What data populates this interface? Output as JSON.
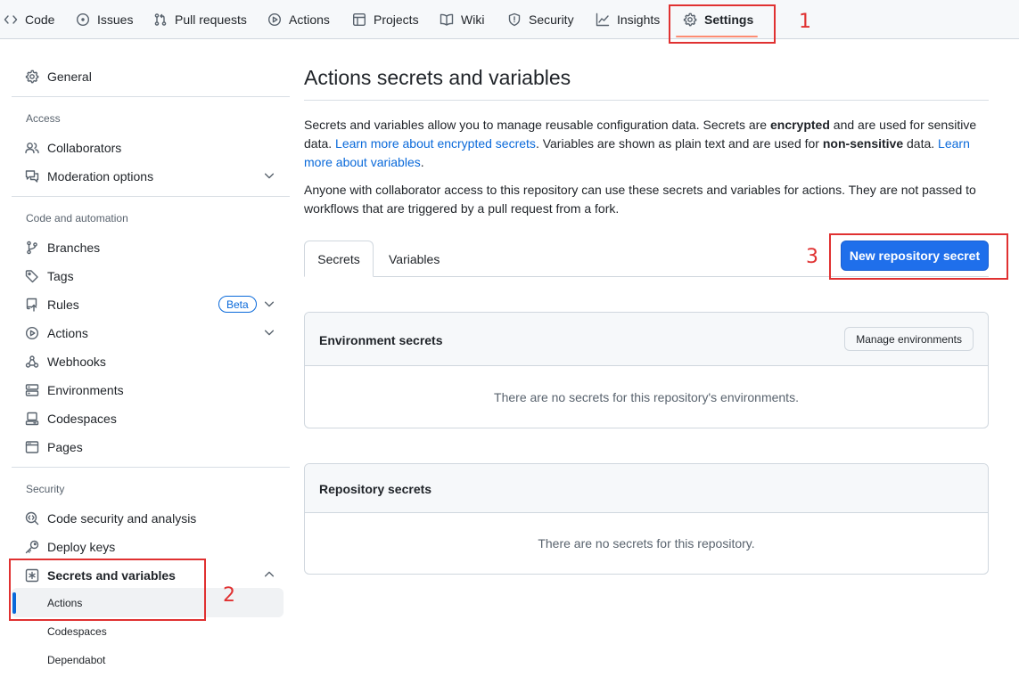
{
  "topnav": {
    "tabs": [
      {
        "label": "Code",
        "icon": "code-icon"
      },
      {
        "label": "Issues",
        "icon": "issue-icon"
      },
      {
        "label": "Pull requests",
        "icon": "pull-request-icon"
      },
      {
        "label": "Actions",
        "icon": "play-icon"
      },
      {
        "label": "Projects",
        "icon": "table-icon"
      },
      {
        "label": "Wiki",
        "icon": "book-icon"
      },
      {
        "label": "Security",
        "icon": "shield-icon"
      },
      {
        "label": "Insights",
        "icon": "graph-icon"
      },
      {
        "label": "Settings",
        "icon": "gear-icon"
      }
    ],
    "active": "Settings"
  },
  "annotations": {
    "one": "1",
    "two": "2",
    "three": "3"
  },
  "sidebar": {
    "general": "General",
    "access_heading": "Access",
    "collaborators": "Collaborators",
    "moderation": "Moderation options",
    "code_heading": "Code and automation",
    "branches": "Branches",
    "tags": "Tags",
    "rules": "Rules",
    "beta": "Beta",
    "actions": "Actions",
    "webhooks": "Webhooks",
    "environments": "Environments",
    "codespaces": "Codespaces",
    "pages": "Pages",
    "security_heading": "Security",
    "code_security": "Code security and analysis",
    "deploy_keys": "Deploy keys",
    "secrets": "Secrets and variables",
    "sub_actions": "Actions",
    "sub_codespaces": "Codespaces",
    "sub_dependabot": "Dependabot"
  },
  "main": {
    "title": "Actions secrets and variables",
    "p1_a": "Secrets and variables allow you to manage reusable configuration data. Secrets are ",
    "p1_b": "encrypted",
    "p1_c": " and are used for sensitive data. ",
    "p1_link1": "Learn more about encrypted secrets",
    "p1_d": ". Variables are shown as plain text and are used for ",
    "p1_e": "non-sensitive",
    "p1_f": " data. ",
    "p1_link2": "Learn more about variables",
    "p1_g": ".",
    "p2": "Anyone with collaborator access to this repository can use these secrets and variables for actions. They are not passed to workflows that are triggered by a pull request from a fork.",
    "tab_secrets": "Secrets",
    "tab_variables": "Variables",
    "new_secret_button": "New repository secret",
    "env_title": "Environment secrets",
    "manage_env_button": "Manage environments",
    "env_empty": "There are no secrets for this repository's environments.",
    "repo_title": "Repository secrets",
    "repo_empty": "There are no secrets for this repository."
  },
  "colors": {
    "accent": "#1f6feb",
    "annotation": "#e03131",
    "link": "#0969da",
    "underline": "#fd8c73"
  }
}
